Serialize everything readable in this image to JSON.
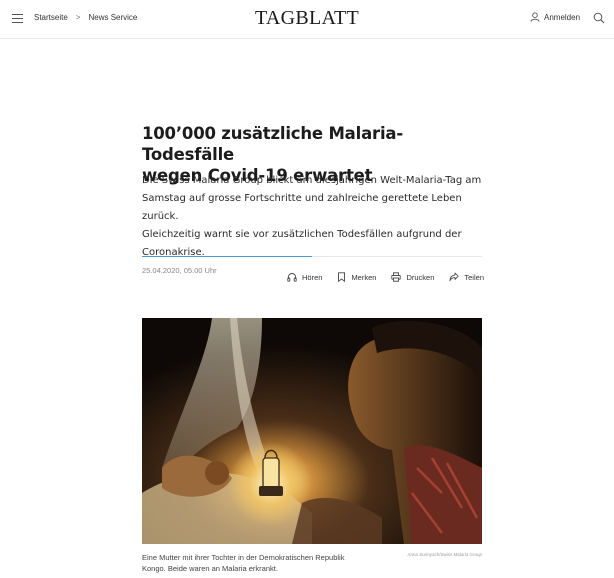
{
  "header": {
    "breadcrumb": [
      "Startseite",
      "News Service"
    ],
    "breadcrumb_separator": ">",
    "logo": "TAGBLATT",
    "login_label": "Anmelden",
    "menu_icon": "hamburger-icon",
    "search_icon": "search-icon",
    "user_icon": "user-icon"
  },
  "article": {
    "title_line1": "100’000 zusätzliche Malaria-Todesfälle",
    "title_line2": "wegen Covid-19 erwartet",
    "lead_line1": "Die Swiss Malaria Group blickt am diesjährigen Welt-Malaria-Tag am",
    "lead_line2": "Samstag auf grosse Fortschritte und zahlreiche gerettete Leben zurück.",
    "lead_line3": "Gleichzeitig warnt sie vor zusätzlichen Todesfällen aufgrund der",
    "lead_line4": "Coronakrise.",
    "date": "25.04.2020, 05.00 Uhr",
    "read_progress_percent": 50,
    "actions": {
      "listen": "Hören",
      "bookmark": "Merken",
      "print": "Drucken",
      "share": "Teilen"
    },
    "image": {
      "caption_line1": "Eine Mutter mit ihrer Tochter in der Demokratischen Republik",
      "caption_line2": "Kongo. Beide waren an Malaria erkrankt.",
      "credit": "Anna Surinyach/Swiss Malaria Group"
    }
  },
  "colors": {
    "accent": "#4a9ad4",
    "text": "#1c1c1c",
    "muted": "#888888"
  }
}
